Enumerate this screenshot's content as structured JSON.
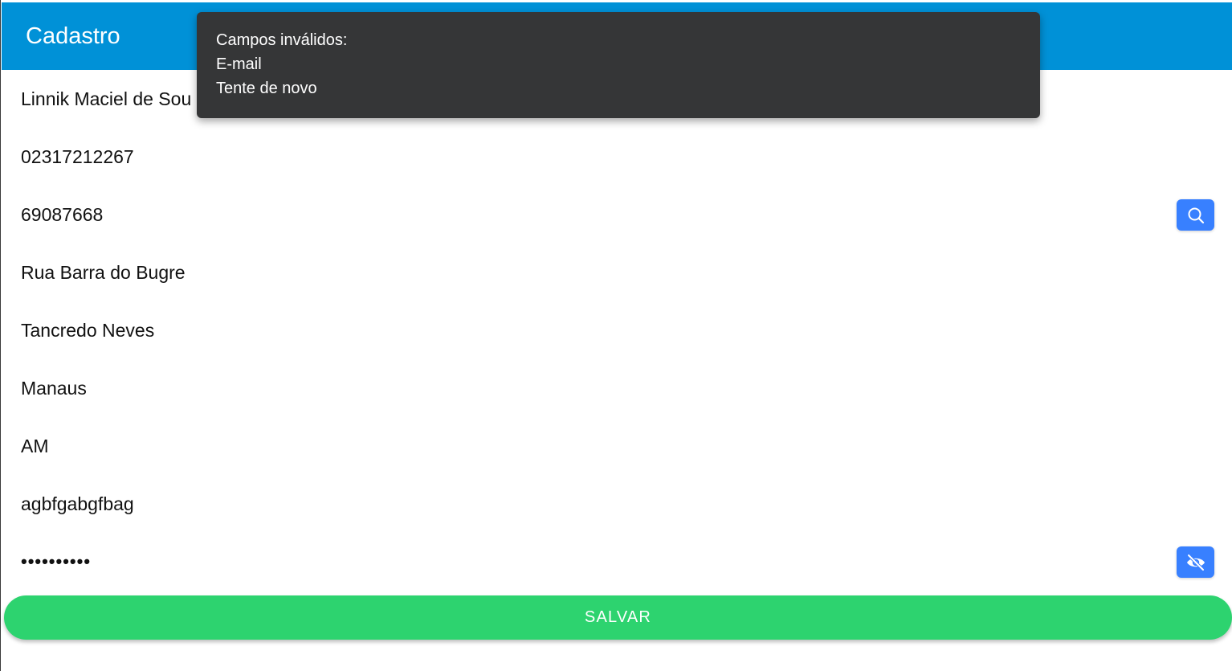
{
  "header": {
    "title": "Cadastro"
  },
  "form": {
    "fields": [
      {
        "value": "Linnik Maciel de Sou"
      },
      {
        "value": "02317212267"
      },
      {
        "value": "69087668",
        "action_icon": "search-icon"
      },
      {
        "value": "Rua Barra do Bugre"
      },
      {
        "value": "Tancredo Neves"
      },
      {
        "value": "Manaus"
      },
      {
        "value": "AM"
      },
      {
        "value": "agbfgabgfbag"
      },
      {
        "value": "••••••••••",
        "action_icon": "eye-off-icon"
      }
    ],
    "save_label": "SALVAR"
  },
  "toast": {
    "lines": [
      "Campos inválidos:",
      "E-mail",
      "Tente de novo"
    ]
  },
  "colors": {
    "toolbar": "#0091d7",
    "icon_button": "#3880ff",
    "save_button": "#2dd36f",
    "toast_background": "#353637"
  }
}
